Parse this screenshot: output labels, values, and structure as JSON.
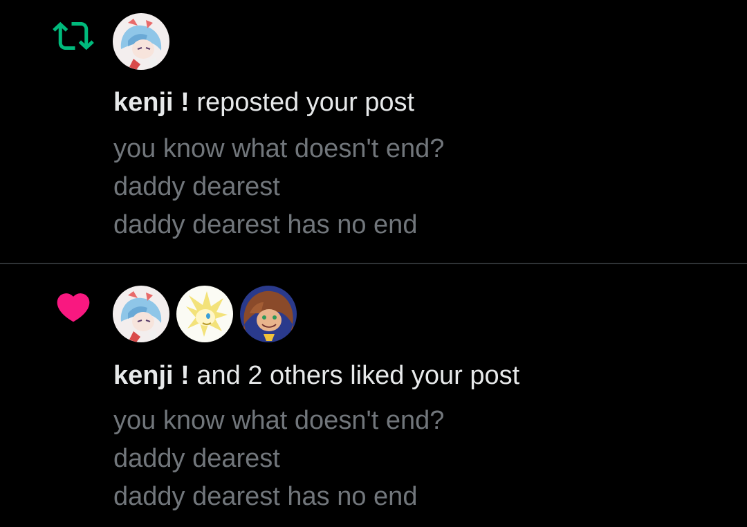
{
  "colors": {
    "background": "#000000",
    "divider": "#2f3336",
    "primary_text": "#e7e9ea",
    "secondary_text": "#71767b",
    "repost_green": "#00ba7c",
    "like_pink": "#f91880"
  },
  "notifications": [
    {
      "type": "repost",
      "icon": "repost-icon",
      "avatars": [
        "avatar-blue-haired-character"
      ],
      "user": "kenji !",
      "action": " reposted your post",
      "post_lines": [
        "you know what doesn't end?",
        "daddy dearest",
        "daddy dearest has no end"
      ]
    },
    {
      "type": "like",
      "icon": "heart-icon",
      "avatars": [
        "avatar-blue-haired-character",
        "avatar-golden-hedgehog",
        "avatar-brown-haired-character"
      ],
      "user": "kenji !",
      "action": " and 2 others liked your post",
      "post_lines": [
        "you know what doesn't end?",
        "daddy dearest",
        "daddy dearest has no end"
      ]
    }
  ]
}
